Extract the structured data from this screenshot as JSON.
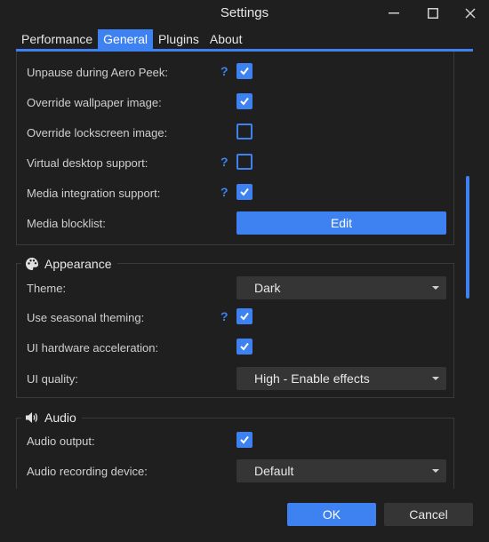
{
  "window": {
    "title": "Settings"
  },
  "tabs": [
    "Performance",
    "General",
    "Plugins",
    "About"
  ],
  "group1": {
    "rows": [
      {
        "label": "Unpause during Aero Peek:",
        "help": "?",
        "checked": true
      },
      {
        "label": "Override wallpaper image:",
        "checked": true
      },
      {
        "label": "Override lockscreen image:",
        "checked": false
      },
      {
        "label": "Virtual desktop support:",
        "help": "?",
        "checked": false
      },
      {
        "label": "Media integration support:",
        "help": "?",
        "checked": true
      }
    ],
    "blocklist_label": "Media blocklist:",
    "edit_label": "Edit"
  },
  "appearance": {
    "title": "Appearance",
    "icon": "palette-icon",
    "theme_label": "Theme:",
    "theme_value": "Dark",
    "seasonal_label": "Use seasonal theming:",
    "seasonal_help": "?",
    "seasonal_checked": true,
    "hwaccel_label": "UI hardware acceleration:",
    "hwaccel_checked": true,
    "quality_label": "UI quality:",
    "quality_value": "High - Enable effects"
  },
  "audio": {
    "title": "Audio",
    "icon": "speaker-icon",
    "output_label": "Audio output:",
    "output_checked": true,
    "recording_label": "Audio recording device:",
    "recording_value": "Default"
  },
  "footer": {
    "ok": "OK",
    "cancel": "Cancel"
  },
  "colors": {
    "accent": "#3d82f0",
    "background": "#1f1f1f",
    "control": "#353535"
  }
}
